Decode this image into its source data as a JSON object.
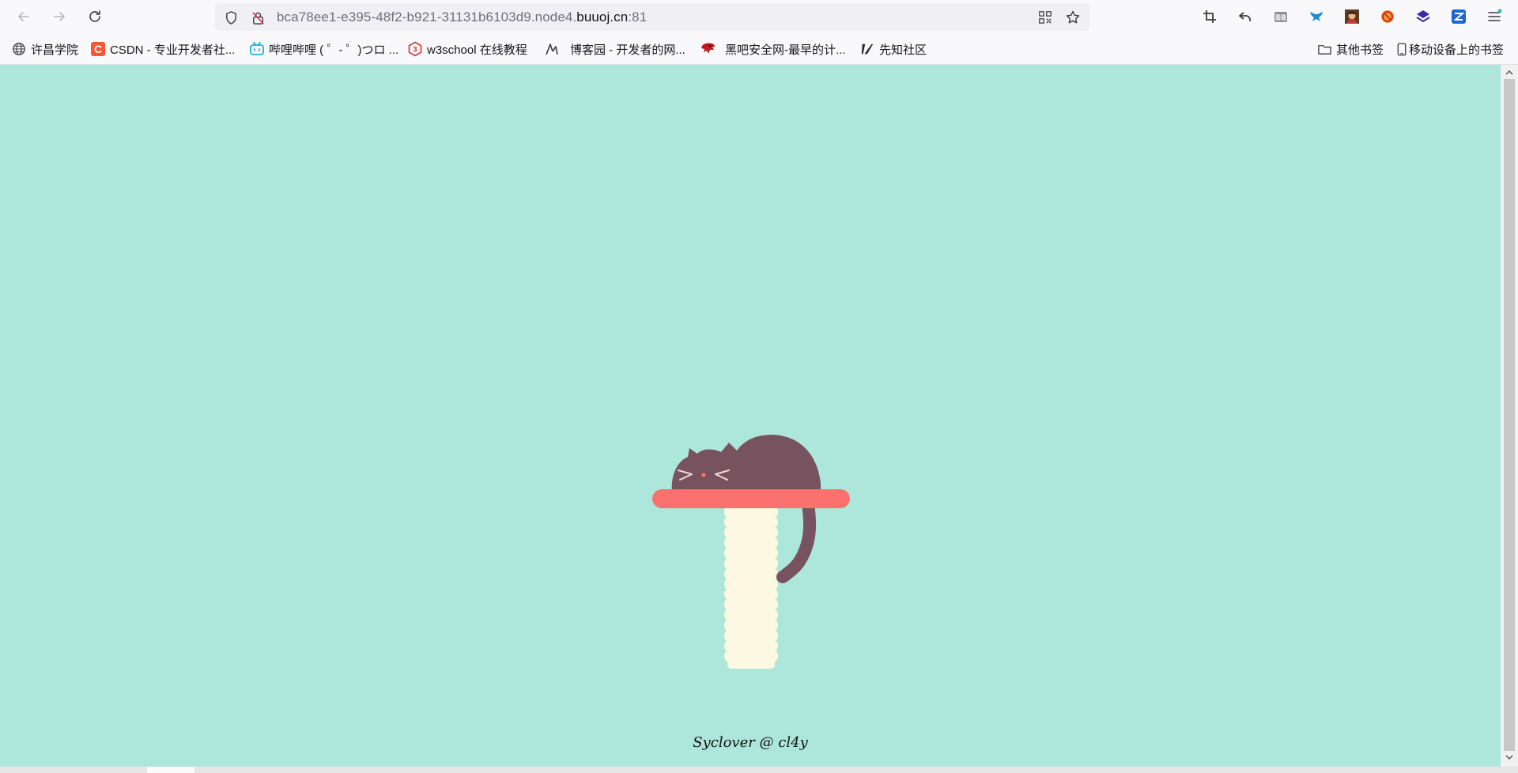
{
  "browser": {
    "url_prefix": "bca78ee1-e395-48f2-b921-31131b6103d9.node4.",
    "url_host": "buuoj.cn",
    "url_suffix": ":81",
    "toolbar_icons": [
      "crop-icon",
      "undo-icon",
      "tabs-icon",
      "bird-extension-icon",
      "avatar-extension-icon",
      "block-extension-icon",
      "layers-extension-icon",
      "zotero-extension-icon",
      "menu-icon"
    ]
  },
  "bookmarks": {
    "items": [
      {
        "label": "许昌学院",
        "icon": "globe-icon"
      },
      {
        "label": "CSDN - 专业开发者社...",
        "icon": "csdn-icon"
      },
      {
        "label": "哔哩哔哩 ( ゜- ゜)つロ ...",
        "icon": "bilibili-icon"
      },
      {
        "label": "w3school 在线教程",
        "icon": "w3school-icon"
      },
      {
        "label": "博客园 - 开发者的网...",
        "icon": "cnblogs-icon"
      },
      {
        "label": "黑吧安全网-最早的计...",
        "icon": "hackbar-icon"
      },
      {
        "label": "先知社区",
        "icon": "xianzhi-icon"
      }
    ],
    "other_folder": "其他书签",
    "mobile_folder": "移动设备上的书签"
  },
  "page": {
    "footer": "Syclover @ cl4y",
    "colors": {
      "background": "#ade6da",
      "cat": "#76535f",
      "shelf": "#fa716f",
      "post": "#fdf8e1"
    }
  }
}
